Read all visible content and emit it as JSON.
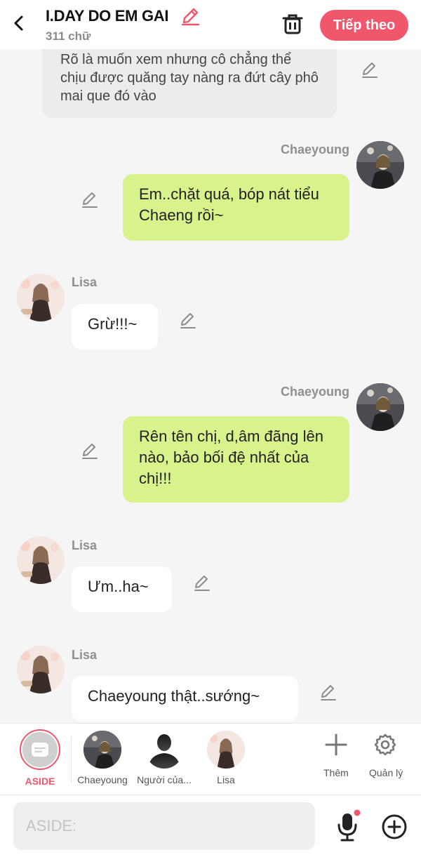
{
  "header": {
    "title": "I.DAY DO EM GAI",
    "word_count": "311 chữ",
    "next_label": "Tiếp theo"
  },
  "messages": [
    {
      "type": "narration",
      "text": "Rõ là muốn xem nhưng cô chẳng thể chịu được quăng tay nàng ra đứt cây phô mai que đó vào"
    },
    {
      "type": "right",
      "sender": "Chaeyoung",
      "text": "Em..chặt quá, bóp nát tiểu Chaeng rồi~"
    },
    {
      "type": "left",
      "sender": "Lisa",
      "text": "Grừ!!!~"
    },
    {
      "type": "right",
      "sender": "Chaeyoung",
      "text": "Rên tên chị, d,âm đãng lên nào, bảo bối đệ nhất của chị!!!"
    },
    {
      "type": "left",
      "sender": "Lisa",
      "text": "Ưm..ha~"
    },
    {
      "type": "left",
      "sender": "Lisa",
      "text": "Chaeyoung thật..sướng~"
    }
  ],
  "characters": [
    {
      "name": "ASIDE",
      "icon": "aside-icon"
    },
    {
      "name": "Chaeyoung",
      "icon": "avatar"
    },
    {
      "name": "Người của...",
      "icon": "silhouette-icon"
    },
    {
      "name": "Lisa",
      "icon": "avatar"
    }
  ],
  "tools": {
    "add_label": "Thêm",
    "manage_label": "Quản lý"
  },
  "input": {
    "placeholder": "ASIDE:"
  },
  "colors": {
    "accent": "#f0566c",
    "green_bubble": "#d8f28c",
    "gray_bubble": "#ececec"
  }
}
